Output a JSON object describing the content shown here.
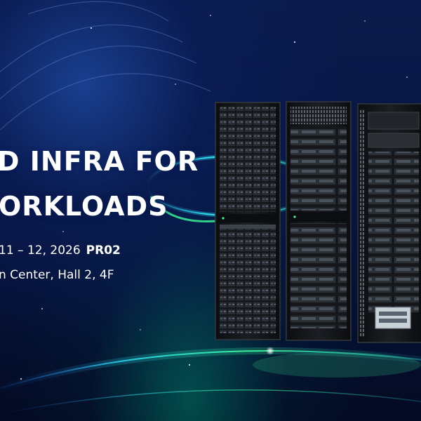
{
  "headline": {
    "line1": "D INFRA FOR",
    "line2": "ORKLOADS"
  },
  "event": {
    "dates": "11 – 12, 2026",
    "code": "PR02",
    "venue": "n Center, Hall 2, 4F"
  },
  "colors": {
    "background": "#071644",
    "glow_cyan": "#2fe4ff",
    "glow_green": "#3cff9a",
    "rack": "#141518",
    "text": "#ffffff"
  },
  "imagery": {
    "racks": [
      "server-rack-icon",
      "server-rack-icon",
      "server-rack-icon"
    ]
  }
}
